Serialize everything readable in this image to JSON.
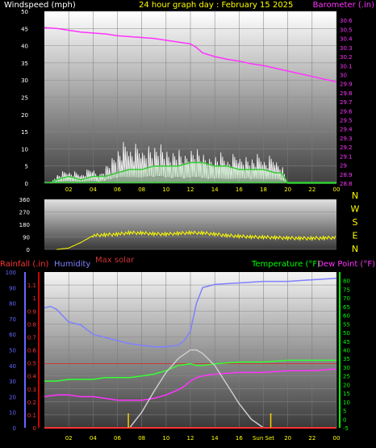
{
  "header": {
    "windspeed_label": "Windspeed (mph)",
    "title": "24 hour graph day : February 15 2025",
    "barometer_label": "Barometer (.in)"
  },
  "labels": {
    "max_solar": "Max solar",
    "rainfall": "Rainfall (.in)",
    "humidity": "Humidity",
    "temperature": "Temperature (°F)",
    "dew_point": "Dew Point (°F)",
    "sun_set": "Sun Set"
  },
  "colors": {
    "wind_gust": "#ffffff",
    "wind_avg": "#33cc33",
    "wind_avg_fill": "#c8f0c8",
    "barometer": "#ff33ff",
    "direction": "#ffff00",
    "humidity": "#8080ff",
    "temperature": "#33ff33",
    "dew_point": "#ff33ff",
    "rainfall": "#ff3333",
    "solar": "#cccccc",
    "rain_axis": "#cc0000",
    "humidity_axis": "#6666ff",
    "temp_axis": "#00ff00"
  },
  "chart_data": [
    {
      "id": "wind_baro",
      "type": "line",
      "x_ticks": [
        "02",
        "04",
        "06",
        "08",
        "10",
        "12",
        "14",
        "16",
        "18",
        "20",
        "22",
        "00"
      ],
      "x_unit": "hour",
      "ylim_left": [
        0,
        50
      ],
      "y_ticks_left": [
        "0",
        "5",
        "10",
        "15",
        "20",
        "25",
        "30",
        "35",
        "40",
        "45",
        "50"
      ],
      "ylabel_left": "Windspeed (mph)",
      "ylim_right": [
        28.8,
        30.7
      ],
      "y_ticks_right": [
        "28.8",
        "28.9",
        "29",
        "29.1",
        "29.2",
        "29.3",
        "29.4",
        "29.5",
        "29.6",
        "29.7",
        "29.8",
        "29.9",
        "30",
        "30.1",
        "30.2",
        "30.3",
        "30.4",
        "30.5",
        "30.6"
      ],
      "ylabel_right": "Barometer (.in)",
      "series": [
        {
          "name": "Windspeed gust",
          "x": [
            0.5,
            1,
            2,
            3,
            4,
            4.5,
            5,
            5.5,
            6,
            7,
            8,
            8.5,
            9,
            9.5,
            10,
            10.5,
            11,
            11.5,
            12,
            12.5,
            13,
            13.5,
            14,
            15,
            16,
            16.5,
            17,
            18,
            19,
            19.5,
            20,
            24
          ],
          "y": [
            0,
            3,
            4,
            3,
            5,
            3,
            6,
            9,
            12,
            12,
            11,
            14,
            13,
            15,
            12,
            11,
            13,
            10,
            12,
            13,
            11,
            9,
            10,
            8,
            9,
            10,
            9,
            8,
            8,
            7,
            0,
            0
          ]
        },
        {
          "name": "Windspeed average",
          "x": [
            0.5,
            1,
            2,
            3,
            4,
            5,
            6,
            7,
            8,
            9,
            10,
            11,
            12,
            13,
            14,
            15,
            16,
            17,
            18,
            19,
            19.5,
            20,
            24
          ],
          "y": [
            0,
            1,
            2,
            1,
            2,
            2,
            3,
            4,
            4,
            5,
            5,
            5,
            6,
            6,
            5,
            5,
            4,
            4,
            4,
            3,
            3,
            0,
            0
          ]
        },
        {
          "name": "Barometer",
          "x": [
            0,
            1,
            2,
            3,
            4,
            5,
            6,
            7,
            8,
            9,
            10,
            11,
            12,
            12.5,
            13,
            14,
            15,
            16,
            17,
            18,
            19,
            20,
            21,
            22,
            23,
            24
          ],
          "y": [
            30.52,
            30.51,
            30.49,
            30.47,
            30.46,
            30.45,
            30.43,
            30.42,
            30.41,
            30.4,
            30.38,
            30.36,
            30.34,
            30.3,
            30.24,
            30.2,
            30.17,
            30.15,
            30.12,
            30.1,
            30.07,
            30.04,
            30.01,
            29.98,
            29.95,
            29.92
          ]
        }
      ]
    },
    {
      "id": "direction",
      "type": "line",
      "x_ticks": [
        "02",
        "04",
        "06",
        "08",
        "10",
        "12",
        "14",
        "16",
        "18",
        "20",
        "22",
        "00"
      ],
      "ylim": [
        0,
        360
      ],
      "y_ticks": [
        "0",
        "90",
        "180",
        "270",
        "360"
      ],
      "compass": [
        "N",
        "W",
        "S",
        "E",
        "N"
      ],
      "series": [
        {
          "name": "Wind direction",
          "x": [
            1,
            2,
            3,
            4,
            5,
            6,
            7,
            8,
            9,
            10,
            11,
            12,
            13,
            14,
            15,
            16,
            17,
            18,
            19,
            20,
            21,
            22,
            23,
            24
          ],
          "y": [
            0,
            10,
            50,
            100,
            105,
            110,
            120,
            118,
            112,
            110,
            115,
            120,
            118,
            110,
            100,
            95,
            90,
            88,
            85,
            82,
            80,
            80,
            82,
            85
          ]
        }
      ]
    },
    {
      "id": "temp_hum",
      "type": "line",
      "x_ticks": [
        "02",
        "04",
        "06",
        "08",
        "10",
        "12",
        "14",
        "16",
        "Sun Set",
        "20",
        "22",
        "00"
      ],
      "ylim_rain": [
        0,
        1.2
      ],
      "y_ticks_rain": [
        "0",
        "0.1",
        "0.2",
        "0.3",
        "0.4",
        "0.5",
        "0.6",
        "0.7",
        "0.8",
        "0.9",
        "1",
        "1.1"
      ],
      "ylim_humidity": [
        0,
        100
      ],
      "y_ticks_humidity": [
        "0",
        "10",
        "20",
        "30",
        "40",
        "50",
        "60",
        "70",
        "80",
        "90",
        "100"
      ],
      "ylim_temp": [
        -5,
        85
      ],
      "y_ticks_temp": [
        "-5",
        "0",
        "5",
        "10",
        "15",
        "20",
        "25",
        "30",
        "35",
        "40",
        "45",
        "50",
        "55",
        "60",
        "65",
        "70",
        "75",
        "80"
      ],
      "series": [
        {
          "name": "Humidity",
          "axis": "humidity",
          "x": [
            0,
            0.5,
            1,
            1.5,
            2,
            3,
            3.5,
            4,
            5,
            6,
            7,
            8,
            9,
            10,
            11,
            11.5,
            12,
            12.5,
            13,
            14,
            16,
            18,
            20,
            22,
            24
          ],
          "y": [
            77,
            78,
            76,
            72,
            68,
            66,
            63,
            60,
            58,
            56,
            54,
            53,
            52,
            52,
            53,
            56,
            62,
            80,
            90,
            92,
            93,
            94,
            94,
            95,
            96
          ]
        },
        {
          "name": "Temperature",
          "axis": "temp",
          "x": [
            0,
            1,
            2,
            3,
            4,
            5,
            6,
            7,
            8,
            9,
            10,
            11,
            12,
            12.5,
            13,
            14,
            16,
            18,
            20,
            22,
            24
          ],
          "y": [
            22,
            22,
            23,
            23,
            23,
            24,
            24,
            24,
            25,
            26,
            28,
            31,
            32,
            31,
            31,
            32,
            33,
            33,
            34,
            34,
            34
          ]
        },
        {
          "name": "Dew Point",
          "axis": "temp",
          "x": [
            0,
            1,
            2,
            3,
            4,
            5,
            6,
            7,
            8,
            9,
            10,
            11,
            11.5,
            12,
            12.5,
            13,
            14,
            16,
            18,
            20,
            22,
            24
          ],
          "y": [
            13,
            14,
            14,
            13,
            13,
            12,
            11,
            11,
            11,
            12,
            14,
            17,
            19,
            22,
            24,
            25,
            26,
            27,
            27,
            28,
            28,
            29
          ]
        },
        {
          "name": "Max solar",
          "axis": "temp",
          "x": [
            7,
            8,
            9,
            10,
            11,
            12,
            12.5,
            13,
            14,
            15,
            16,
            17,
            18
          ],
          "y": [
            -5,
            4,
            16,
            27,
            35,
            40,
            40,
            38,
            31,
            20,
            9,
            0,
            -5
          ]
        },
        {
          "name": "Rainfall",
          "axis": "rain",
          "x": [
            0,
            24
          ],
          "y": [
            0,
            0
          ]
        }
      ]
    }
  ]
}
